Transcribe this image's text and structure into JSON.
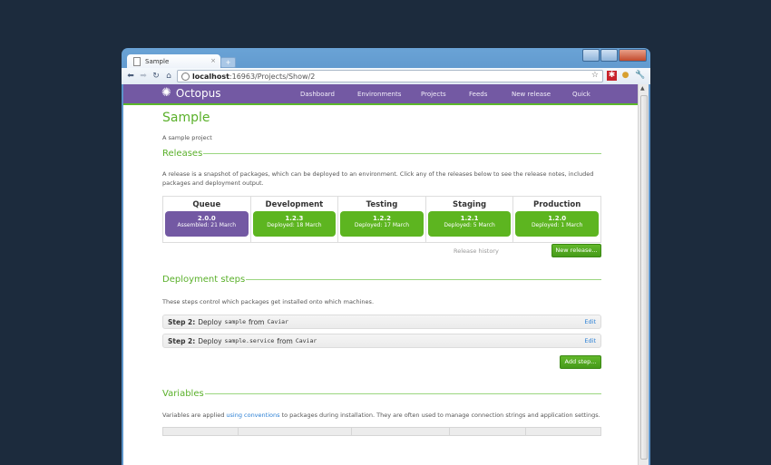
{
  "browser": {
    "tab_title": "Sample",
    "url_host": "localhost",
    "url_rest": ":16963/Projects/Show/2"
  },
  "app": {
    "logo": "Octopus",
    "nav": [
      "Dashboard",
      "Environments",
      "Projects",
      "Feeds",
      "New release",
      "Quick"
    ]
  },
  "project": {
    "title": "Sample",
    "description": "A sample project"
  },
  "releases": {
    "heading": "Releases",
    "description": "A release is a snapshot of packages, which can be deployed to an environment. Click any of the releases below to see the release notes, included packages and deployment output.",
    "columns": [
      {
        "name": "Queue",
        "version": "2.0.0",
        "date": "Assembled: 21 March",
        "kind": "queue"
      },
      {
        "name": "Development",
        "version": "1.2.3",
        "date": "Deployed: 18 March",
        "kind": "env"
      },
      {
        "name": "Testing",
        "version": "1.2.2",
        "date": "Deployed: 17 March",
        "kind": "env"
      },
      {
        "name": "Staging",
        "version": "1.2.1",
        "date": "Deployed: 5 March",
        "kind": "env"
      },
      {
        "name": "Production",
        "version": "1.2.0",
        "date": "Deployed: 1 March",
        "kind": "env"
      }
    ],
    "history_link": "Release history",
    "new_release_button": "New release..."
  },
  "deployment_steps": {
    "heading": "Deployment steps",
    "description": "These steps control which packages get installed onto which machines.",
    "steps": [
      {
        "label": "Step 2:",
        "action": "Deploy",
        "package": "sample",
        "from": "from",
        "feed": "Caviar",
        "edit": "Edit"
      },
      {
        "label": "Step 2:",
        "action": "Deploy",
        "package": "sample.service",
        "from": "from",
        "feed": "Caviar",
        "edit": "Edit"
      }
    ],
    "add_step_button": "Add step..."
  },
  "variables": {
    "heading": "Variables",
    "text_before": "Variables are applied ",
    "link": "using conventions",
    "text_after": " to packages during installation. They are often used to manage connection strings and application settings."
  },
  "colors": {
    "brand_purple": "#7359a3",
    "accent_green": "#5ab02a",
    "link_blue": "#2a7fd4"
  }
}
